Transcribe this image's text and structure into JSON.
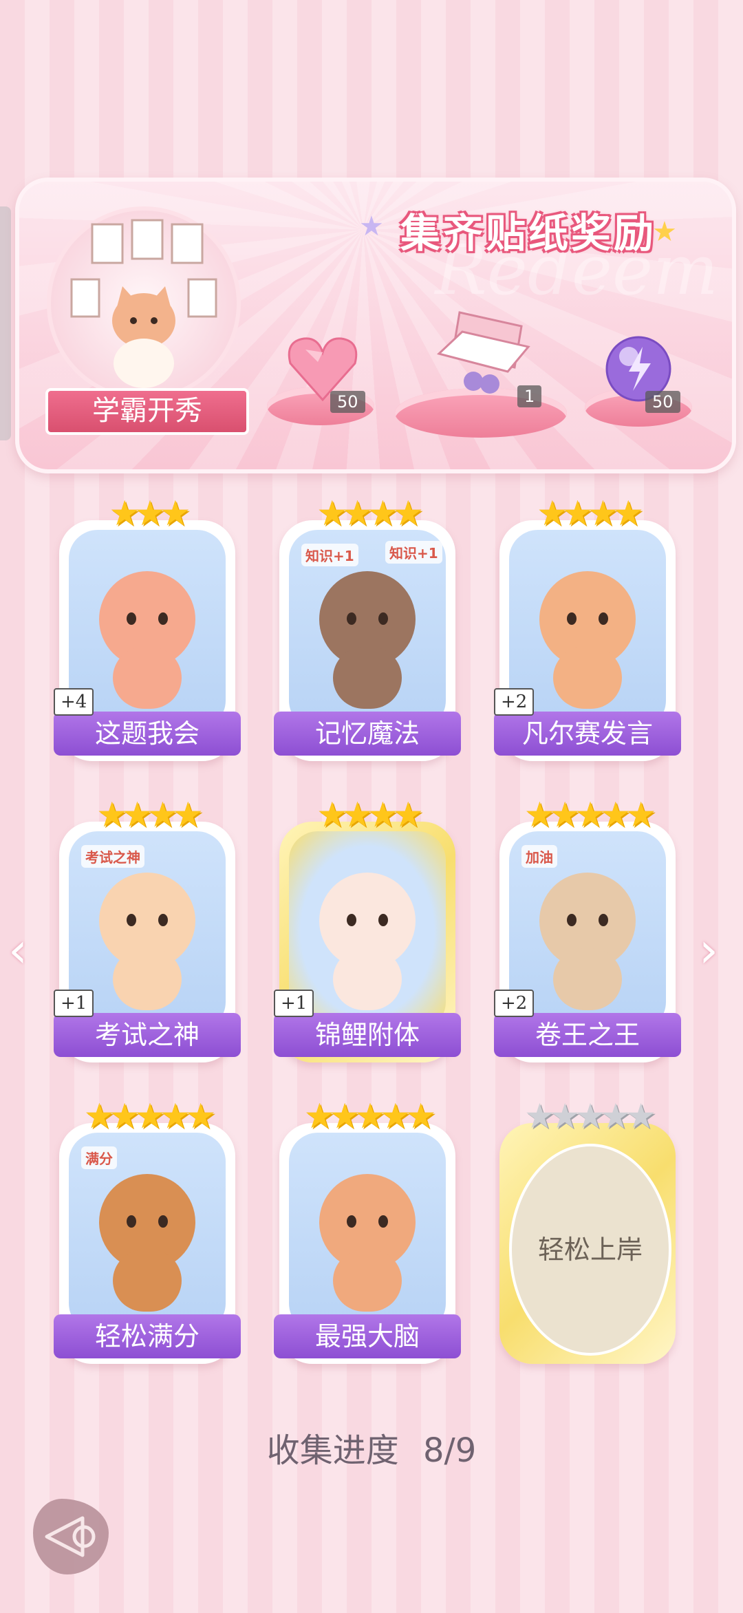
{
  "banner": {
    "title": "集齐贴纸奖励",
    "watermark": "Redeem",
    "portrait_label": "学霸开秀",
    "rewards": [
      {
        "icon": "pink-heart-gem-icon",
        "count": "50"
      },
      {
        "icon": "gift-box-icon",
        "count": "1"
      },
      {
        "icon": "purple-energy-orb-icon",
        "count": "50"
      }
    ]
  },
  "stickers": [
    {
      "name": "这题我会",
      "stars": 3,
      "bonus": "+4",
      "animal": "bear-at-desk",
      "color": "#f6a98e",
      "locked": false,
      "gold": false
    },
    {
      "name": "记忆魔法",
      "stars": 4,
      "bonus": "",
      "animal": "otter-wizard",
      "color": "#9c7560",
      "locked": false,
      "gold": false,
      "overlay_text": [
        "知识+1",
        "知识+1"
      ]
    },
    {
      "name": "凡尔赛发言",
      "stars": 4,
      "bonus": "+2",
      "animal": "lion-with-mic",
      "color": "#f3b184",
      "locked": false,
      "gold": false
    },
    {
      "name": "考试之神",
      "stars": 4,
      "bonus": "+1",
      "animal": "angel-cat",
      "color": "#f9d3b0",
      "locked": false,
      "gold": false,
      "overlay_text": [
        "考试之神"
      ]
    },
    {
      "name": "锦鲤附体",
      "stars": 4,
      "bonus": "+1",
      "animal": "bear-with-koi",
      "color": "#fbe7de",
      "locked": false,
      "gold": true
    },
    {
      "name": "卷王之王",
      "stars": 5,
      "bonus": "+2",
      "animal": "cat-studying",
      "color": "#e7c9a9",
      "locked": false,
      "gold": false,
      "overlay_text": [
        "加油"
      ]
    },
    {
      "name": "轻松满分",
      "stars": 5,
      "bonus": "",
      "animal": "puppy-full-marks",
      "color": "#d98f53",
      "locked": false,
      "gold": false,
      "overlay_text": [
        "满分"
      ]
    },
    {
      "name": "最强大脑",
      "stars": 5,
      "bonus": "",
      "animal": "cat-with-papers",
      "color": "#f0a97d",
      "locked": false,
      "gold": false
    },
    {
      "name": "轻松上岸",
      "stars": 5,
      "bonus": "",
      "animal": "",
      "color": "#ebe2cf",
      "locked": true,
      "gold": true
    }
  ],
  "progress": {
    "label": "收集进度",
    "value": "8/9"
  },
  "colors": {
    "accent_pink": "#e8587d",
    "label_purple": "#8d4fd3",
    "star_gold": "#ffc61a"
  }
}
